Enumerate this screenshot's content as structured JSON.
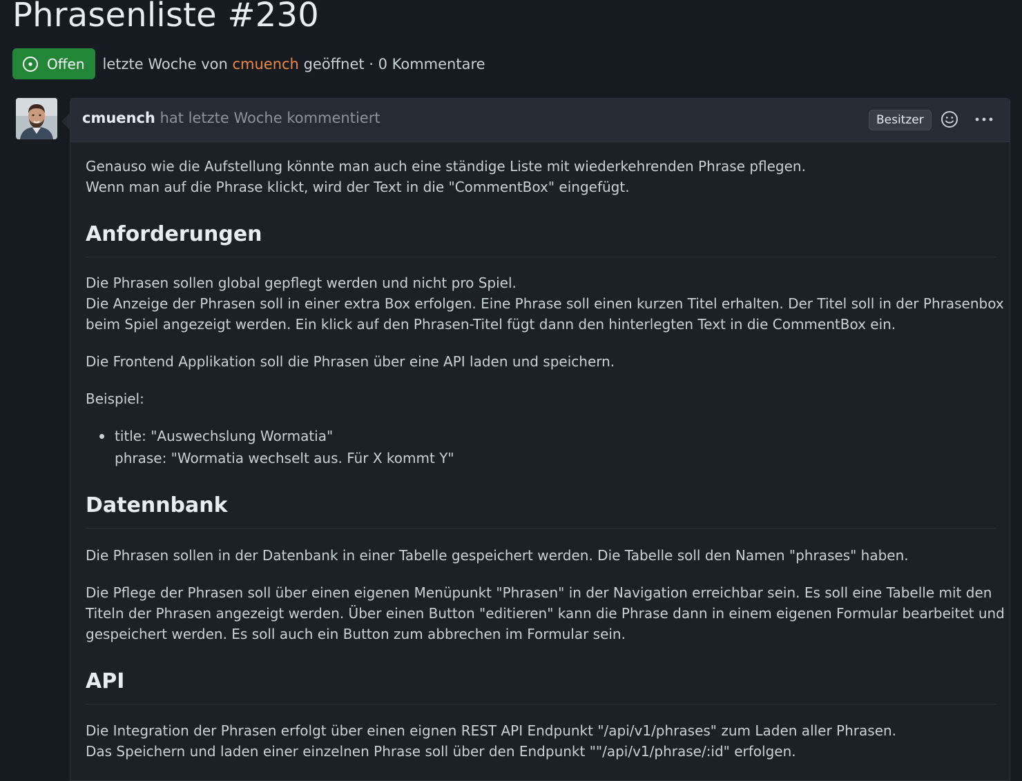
{
  "issue": {
    "title": "Phrasenliste #230",
    "state_label": "Offen",
    "meta_prefix": "letzte Woche von",
    "meta_author": "cmuench",
    "meta_suffix": "geöffnet · 0 Kommentare"
  },
  "comment": {
    "author": "cmuench",
    "action": "hat letzte Woche kommentiert",
    "owner_badge": "Besitzer",
    "intro": [
      "Genauso wie die Aufstellung könnte man auch eine ständige Liste mit wiederkehrenden Phrase pflegen.",
      "Wenn man auf die Phrase klickt, wird der Text in die \"CommentBox\" eingefügt."
    ],
    "sections": {
      "anforderungen": {
        "heading": "Anforderungen",
        "p1": [
          "Die Phrasen sollen global gepflegt werden und nicht pro Spiel.",
          "Die Anzeige der Phrasen soll in einer extra Box erfolgen. Eine Phrase soll einen kurzen Titel erhalten. Der Titel soll in der Phrasenbox",
          "beim Spiel angezeigt werden. Ein klick auf den Phrasen-Titel fügt dann den hinterlegten Text in die CommentBox ein."
        ],
        "p2": "Die Frontend Applikation soll die Phrasen über eine API laden und speichern.",
        "p3": "Beispiel:",
        "list_item": [
          "title: \"Auswechslung Wormatia\"",
          "phrase: \"Wormatia wechselt aus. Für X kommt Y\""
        ]
      },
      "datenbank": {
        "heading": "Datennbank",
        "p1": "Die Phrasen sollen in der Datenbank in einer Tabelle gespeichert werden. Die Tabelle soll den Namen \"phrases\" haben.",
        "p2": [
          "Die Pflege der Phrasen soll über einen eigenen Menüpunkt \"Phrasen\" in der Navigation erreichbar sein. Es soll eine Tabelle mit den",
          "Titeln der Phrasen angezeigt werden. Über einen Button \"editieren\" kann die Phrase dann in einem eigenen Formular bearbeitet und",
          "gespeichert werden. Es soll auch ein Button zum abbrechen im Formular sein."
        ]
      },
      "api": {
        "heading": "API",
        "p1": [
          "Die Integration der Phrasen erfolgt über einen eignen REST API Endpunkt \"/api/v1/phrases\" zum Laden aller Phrasen.",
          "Das Speichern und laden einer einzelnen Phrase soll über den Endpunkt \"\"/api/v1/phrase/:id\" erfolgen."
        ]
      }
    }
  },
  "icons": {
    "state": "issue-opened-icon",
    "emoji": "smiley-icon",
    "more": "kebab-horizontal-icon"
  },
  "colors": {
    "background": "#161b22",
    "open_badge": "#238636",
    "author_link": "#f0883e",
    "comment_header": "#262c36"
  }
}
